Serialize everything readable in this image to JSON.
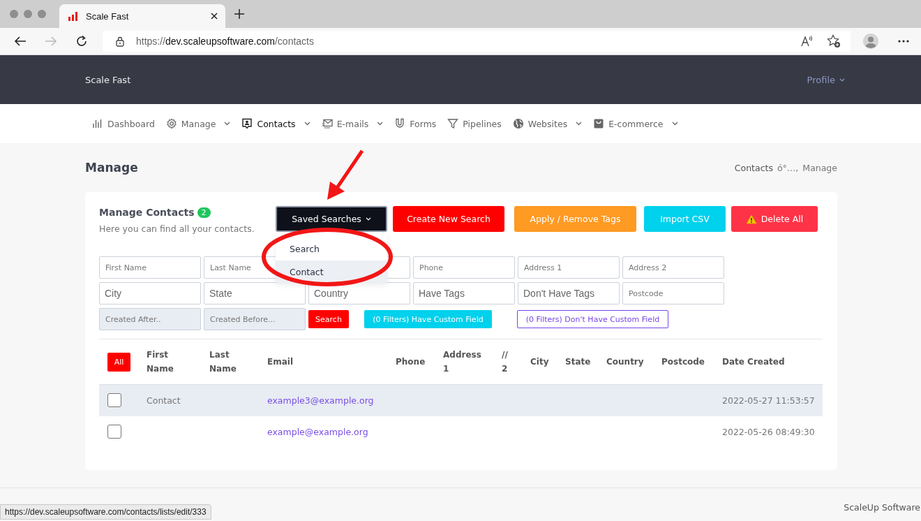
{
  "browser": {
    "tab_title": "Scale Fast",
    "url": {
      "scheme": "https://",
      "host": "dev.scaleupsoftware.com",
      "path": "/contacts"
    }
  },
  "header": {
    "brand": "Scale Fast",
    "profile": "Profile"
  },
  "nav": [
    {
      "label": "Dashboard",
      "kind": "chart",
      "caret": false,
      "selected": false
    },
    {
      "label": "Manage",
      "kind": "gear",
      "caret": true,
      "selected": false
    },
    {
      "label": "Contacts",
      "kind": "contact",
      "caret": true,
      "selected": true
    },
    {
      "label": "E-mails",
      "kind": "mail",
      "caret": true,
      "selected": false
    },
    {
      "label": "Forms",
      "kind": "magnet",
      "caret": false,
      "selected": false
    },
    {
      "label": "Pipelines",
      "kind": "filter",
      "caret": false,
      "selected": false
    },
    {
      "label": "Websites",
      "kind": "globe",
      "caret": true,
      "selected": false
    },
    {
      "label": "E-commerce",
      "kind": "bag",
      "caret": true,
      "selected": false
    }
  ],
  "page": {
    "title": "Manage",
    "breadcrumb": [
      "Contacts",
      "ό°…,",
      "Manage"
    ]
  },
  "card": {
    "title": "Manage Contacts",
    "count": "2",
    "subtitle": "Here you can find all your contacts.",
    "actions": [
      {
        "label": "Saved Searches",
        "kind": "dropdown"
      },
      {
        "label": "Create New Search",
        "kind": "red"
      },
      {
        "label": "Apply / Remove Tags",
        "kind": "orange"
      },
      {
        "label": "Import CSV",
        "kind": "cyan"
      },
      {
        "label": "Delete All",
        "kind": "danger"
      }
    ],
    "dropdown": [
      {
        "label": "Search",
        "selected": false
      },
      {
        "label": "Contact",
        "selected": true
      }
    ],
    "filter_rows": [
      [
        {
          "kind": "input",
          "placeholder": "First Name"
        },
        {
          "kind": "input",
          "placeholder": "Last Name"
        },
        {
          "kind": "input"
        },
        {
          "kind": "input",
          "placeholder": "Phone"
        },
        {
          "kind": "input",
          "placeholder": "Address 1"
        },
        {
          "kind": "input",
          "placeholder": "Address 2"
        }
      ],
      [
        {
          "kind": "tag",
          "placeholder": "City"
        },
        {
          "kind": "tag",
          "placeholder": "State"
        },
        {
          "kind": "tag",
          "placeholder": "Country"
        },
        {
          "kind": "tag",
          "placeholder": "Have Tags"
        },
        {
          "kind": "tag",
          "placeholder": "Don't Have Tags"
        },
        {
          "kind": "input",
          "placeholder": "Postcode"
        }
      ],
      [
        {
          "kind": "date",
          "placeholder": "Created After.."
        },
        {
          "kind": "date",
          "placeholder": "Created Before..."
        },
        {
          "kind": "search",
          "label": "Search"
        },
        {
          "kind": "cyan",
          "label": "(0 Filters) Have Custom Field"
        },
        {
          "kind": "outline",
          "label": "(0 Filters) Don't Have Custom Field"
        }
      ]
    ],
    "table": {
      "select_all": "All",
      "columns": [
        "First\nName",
        "Last\nName",
        "Email",
        "Phone",
        "Address\n1",
        "//\n2",
        "City",
        "State",
        "Country",
        "Postcode",
        "Date Created"
      ],
      "rows": [
        {
          "checked": false,
          "selected": true,
          "cells": [
            "Contact",
            null,
            "example3@example.org",
            null,
            null,
            null,
            null,
            null,
            null,
            null,
            "2022-05-27 11:53:57"
          ]
        },
        {
          "checked": false,
          "selected": false,
          "cells": [
            null,
            null,
            "example@example.org",
            null,
            null,
            null,
            null,
            null,
            null,
            null,
            "2022-05-26 08:49:30"
          ]
        }
      ]
    }
  },
  "footer": {
    "company": "ScaleUp Software"
  },
  "status_url": "https://dev.scaleupsoftware.com/contacts/lists/edit/333",
  "annotations": {
    "arrow": true,
    "ellipse": true
  }
}
